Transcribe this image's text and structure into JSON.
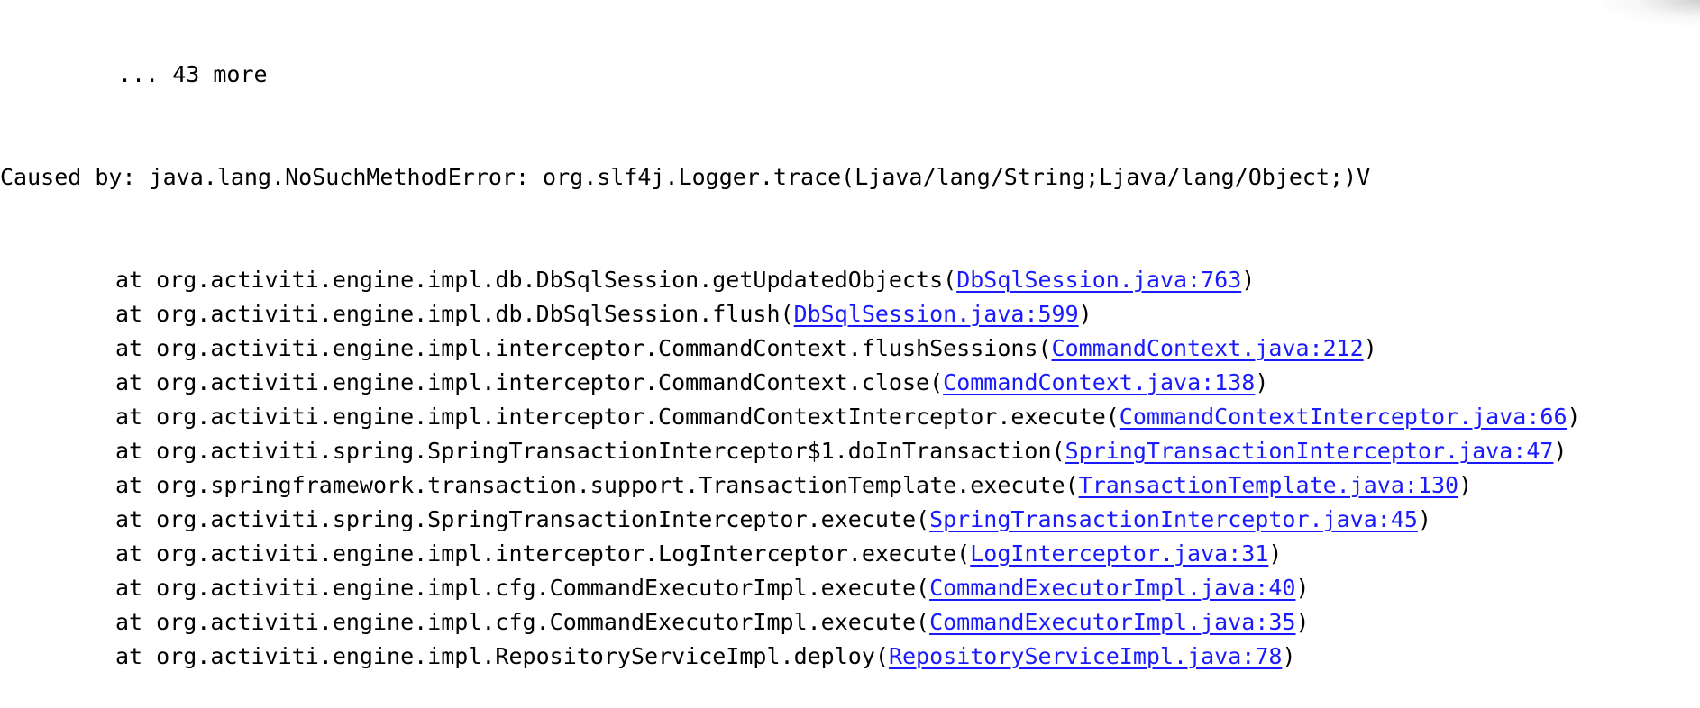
{
  "more_line": "... 43 more",
  "caused_by": "Caused by: java.lang.NoSuchMethodError: org.slf4j.Logger.trace(Ljava/lang/String;Ljava/lang/Object;)V",
  "frames": [
    {
      "prefix": "at org.activiti.engine.impl.db.DbSqlSession.getUpdatedObjects(",
      "link": "DbSqlSession.java:763",
      "suffix": ")"
    },
    {
      "prefix": "at org.activiti.engine.impl.db.DbSqlSession.flush(",
      "link": "DbSqlSession.java:599",
      "suffix": ")"
    },
    {
      "prefix": "at org.activiti.engine.impl.interceptor.CommandContext.flushSessions(",
      "link": "CommandContext.java:212",
      "suffix": ")"
    },
    {
      "prefix": "at org.activiti.engine.impl.interceptor.CommandContext.close(",
      "link": "CommandContext.java:138",
      "suffix": ")"
    },
    {
      "prefix": "at org.activiti.engine.impl.interceptor.CommandContextInterceptor.execute(",
      "link": "CommandContextInterceptor.java:66",
      "suffix": ")"
    },
    {
      "prefix": "at org.activiti.spring.SpringTransactionInterceptor$1.doInTransaction(",
      "link": "SpringTransactionInterceptor.java:47",
      "suffix": ")"
    },
    {
      "prefix": "at org.springframework.transaction.support.TransactionTemplate.execute(",
      "link": "TransactionTemplate.java:130",
      "suffix": ")"
    },
    {
      "prefix": "at org.activiti.spring.SpringTransactionInterceptor.execute(",
      "link": "SpringTransactionInterceptor.java:45",
      "suffix": ")"
    },
    {
      "prefix": "at org.activiti.engine.impl.interceptor.LogInterceptor.execute(",
      "link": "LogInterceptor.java:31",
      "suffix": ")"
    },
    {
      "prefix": "at org.activiti.engine.impl.cfg.CommandExecutorImpl.execute(",
      "link": "CommandExecutorImpl.java:40",
      "suffix": ")"
    },
    {
      "prefix": "at org.activiti.engine.impl.cfg.CommandExecutorImpl.execute(",
      "link": "CommandExecutorImpl.java:35",
      "suffix": ")"
    },
    {
      "prefix": "at org.activiti.engine.impl.RepositoryServiceImpl.deploy(",
      "link": "RepositoryServiceImpl.java:78",
      "suffix": ")"
    }
  ]
}
